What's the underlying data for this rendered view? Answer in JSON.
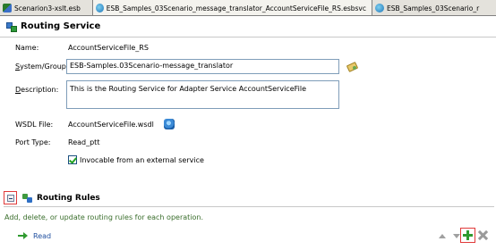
{
  "tabs": [
    {
      "label": "Scenarion3-xslt.esb",
      "icon": "esb-file-icon"
    },
    {
      "label": "ESB_Samples_03Scenario_message_translator_AccountServiceFile_RS.esbsvc",
      "icon": "service-file-icon"
    },
    {
      "label": "ESB_Samples_03Scenario_r",
      "icon": "service-file-icon"
    }
  ],
  "header": {
    "title": "Routing Service"
  },
  "form": {
    "name_label": "Name:",
    "name_value": "AccountServiceFile_RS",
    "system_group_label": "System/Group:",
    "system_group_value": "ESB-Samples.03Scenario-message_translator",
    "description_label": "Description:",
    "description_value": "This is the Routing Service for Adapter Service AccountServiceFile",
    "wsdl_label": "WSDL File:",
    "wsdl_value": "AccountServiceFile.wsdl",
    "port_type_label": "Port Type:",
    "port_type_value": "Read_ptt",
    "invocable_label": "Invocable from an external service",
    "invocable_checked": true
  },
  "routing_rules": {
    "title": "Routing Rules",
    "description": "Add, delete, or update routing rules for each operation.",
    "operations": [
      {
        "label": "Read"
      }
    ]
  },
  "colors": {
    "highlight_box": "#e03a3a",
    "add_green": "#2f9a2f",
    "operation_link": "#1f4f9f"
  }
}
